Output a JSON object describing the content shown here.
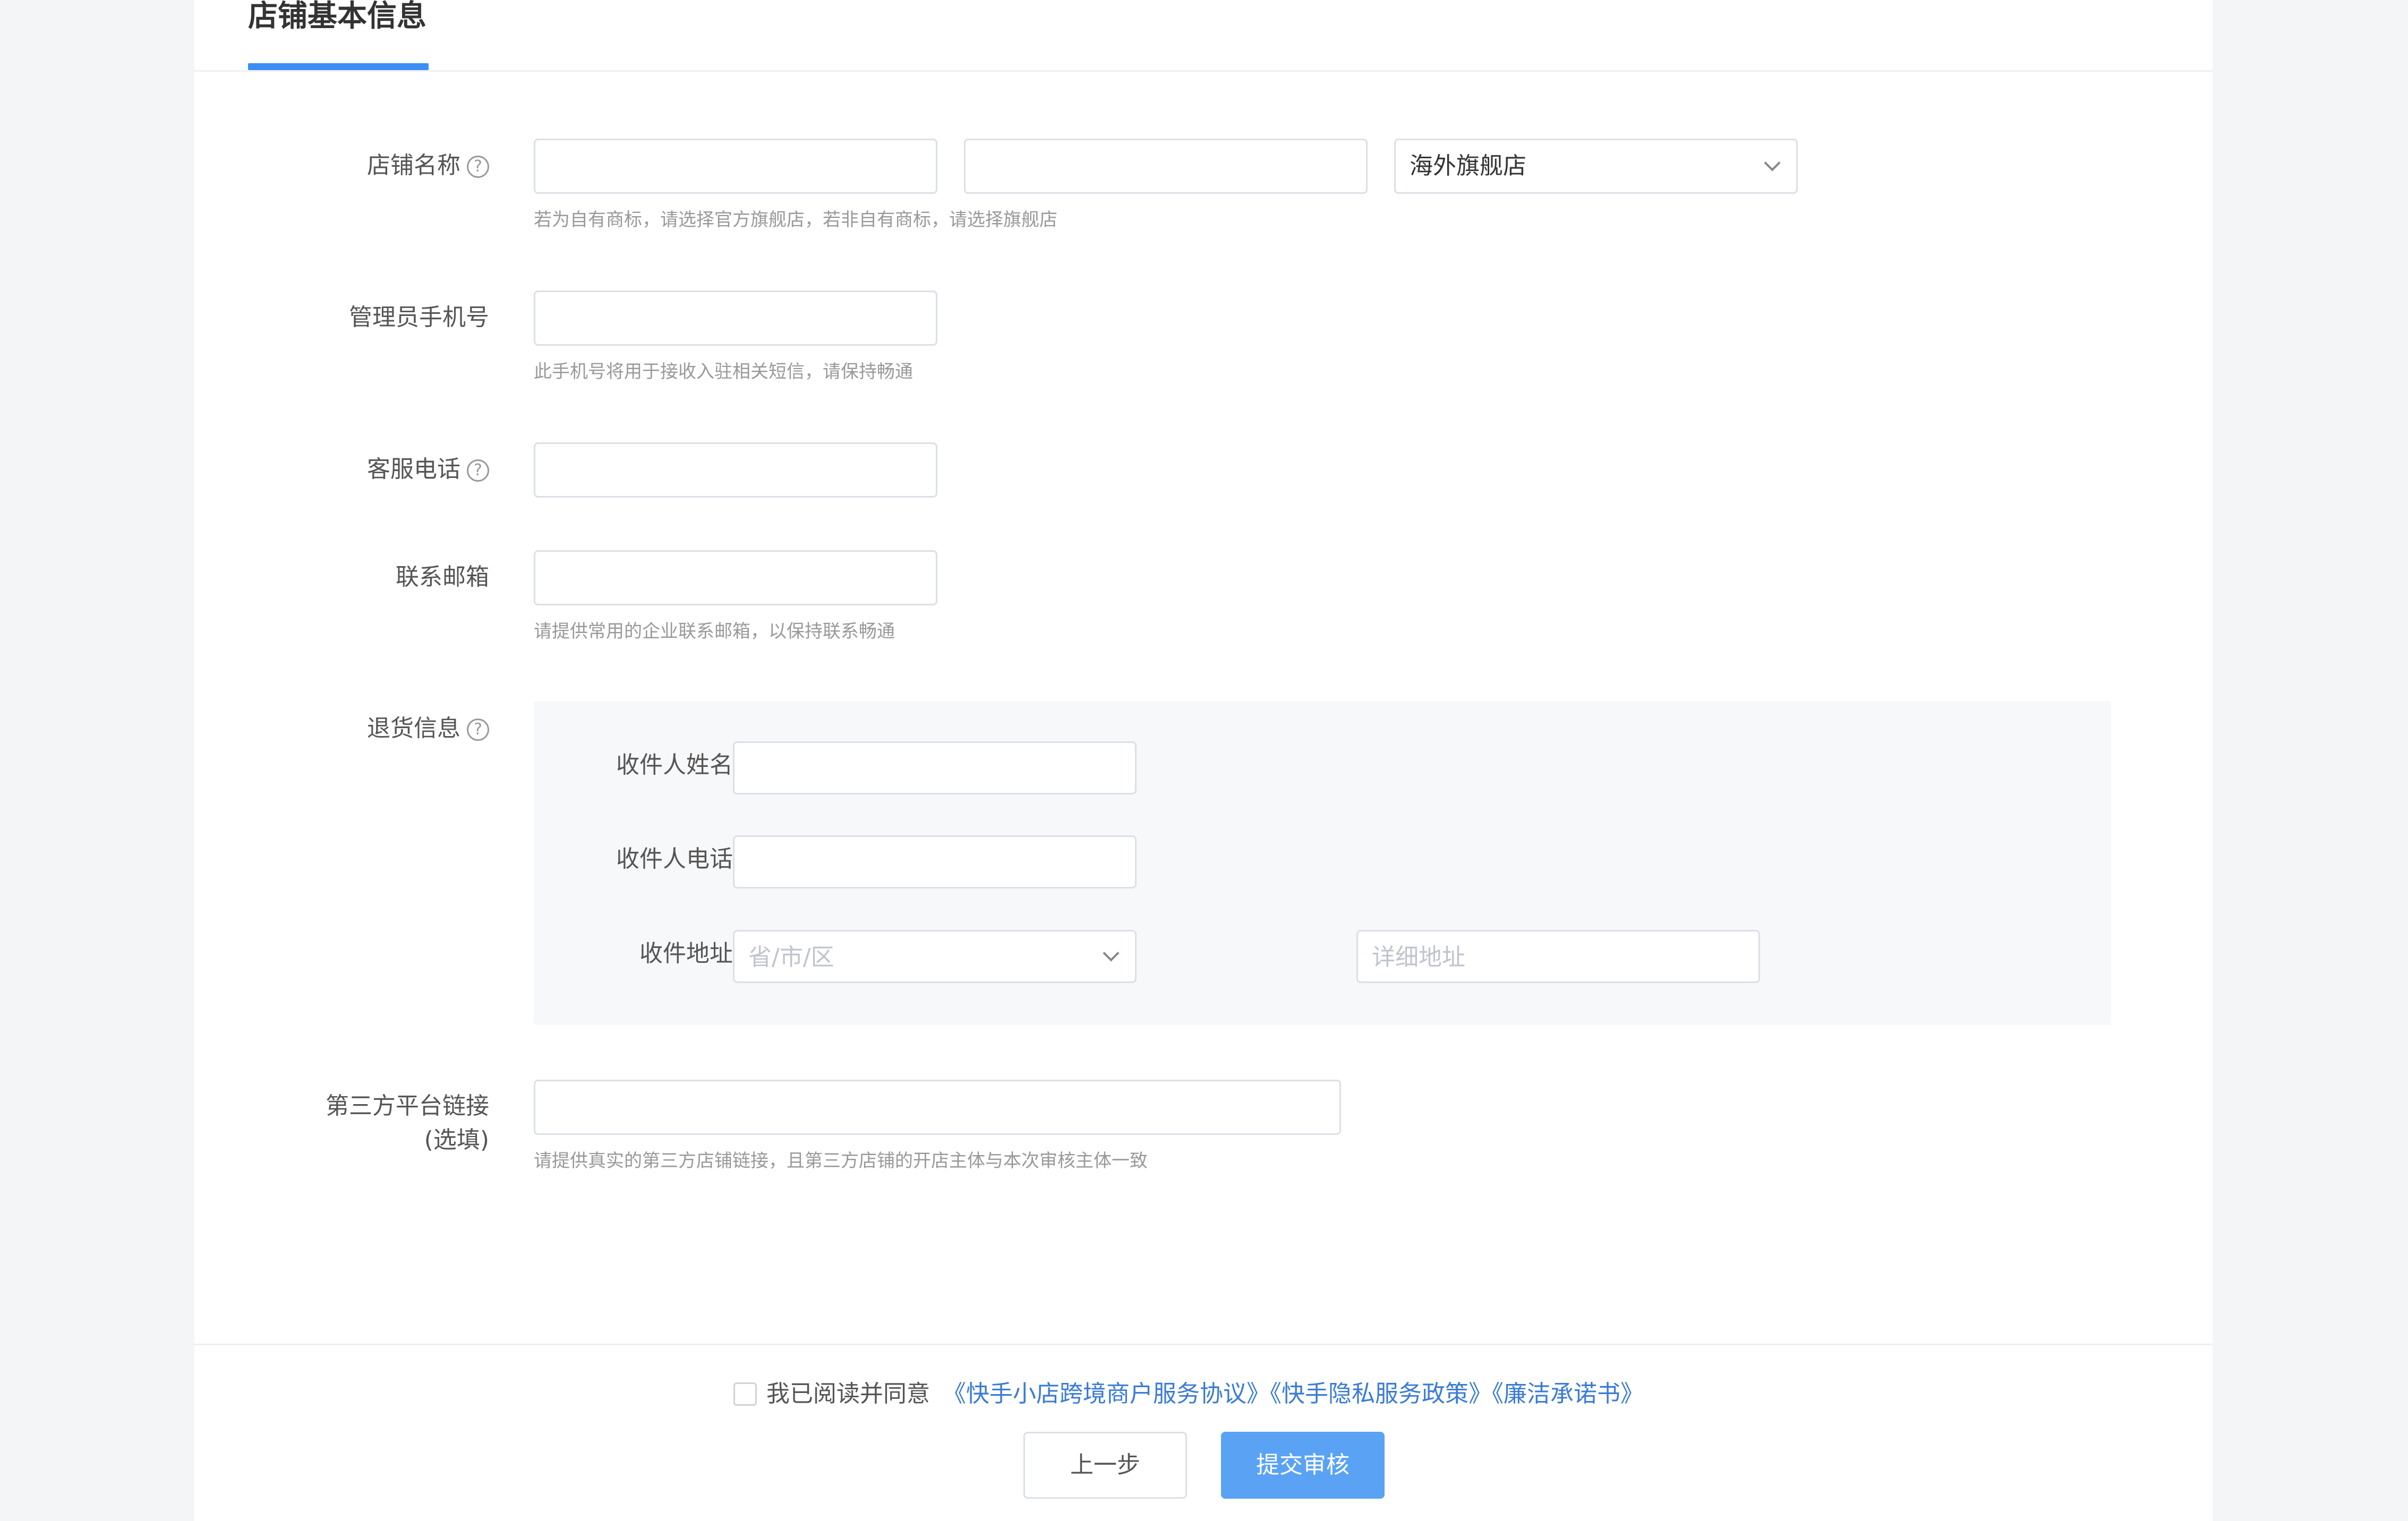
{
  "header": {
    "title": "店铺基本信息"
  },
  "form": {
    "store_name": {
      "label": "店铺名称",
      "field1_value": "",
      "field2_value": "",
      "store_type_selected": "海外旗舰店",
      "hint": "若为自有商标，请选择官方旗舰店，若非自有商标，请选择旗舰店"
    },
    "admin_phone": {
      "label": "管理员手机号",
      "value": "",
      "hint": "此手机号将用于接收入驻相关短信，请保持畅通"
    },
    "service_phone": {
      "label": "客服电话",
      "value": ""
    },
    "contact_email": {
      "label": "联系邮箱",
      "value": "",
      "hint": "请提供常用的企业联系邮箱，以保持联系畅通"
    },
    "return_info": {
      "label": "退货信息",
      "receiver_name_label": "收件人姓名",
      "receiver_name_value": "",
      "receiver_phone_label": "收件人电话",
      "receiver_phone_value": "",
      "address_label": "收件地址",
      "region_placeholder": "省/市/区",
      "detail_placeholder": "详细地址"
    },
    "third_party": {
      "label_line1": "第三方平台链接",
      "label_line2": "(选填)",
      "value": "",
      "hint": "请提供真实的第三方店铺链接，且第三方店铺的开店主体与本次审核主体一致"
    }
  },
  "agreement": {
    "prefix": "我已阅读并同意",
    "link1": "《快手小店跨境商户服务协议》",
    "link2": "《快手隐私服务政策》",
    "link3": "《廉洁承诺书》"
  },
  "buttons": {
    "prev": "上一步",
    "submit": "提交审核"
  },
  "icons": {
    "help": "question-circle-icon",
    "chevron": "chevron-down-icon"
  },
  "colors": {
    "accent": "#3a8ef6",
    "link": "#3a7bd5",
    "submit_bg": "#5aa2f4"
  }
}
